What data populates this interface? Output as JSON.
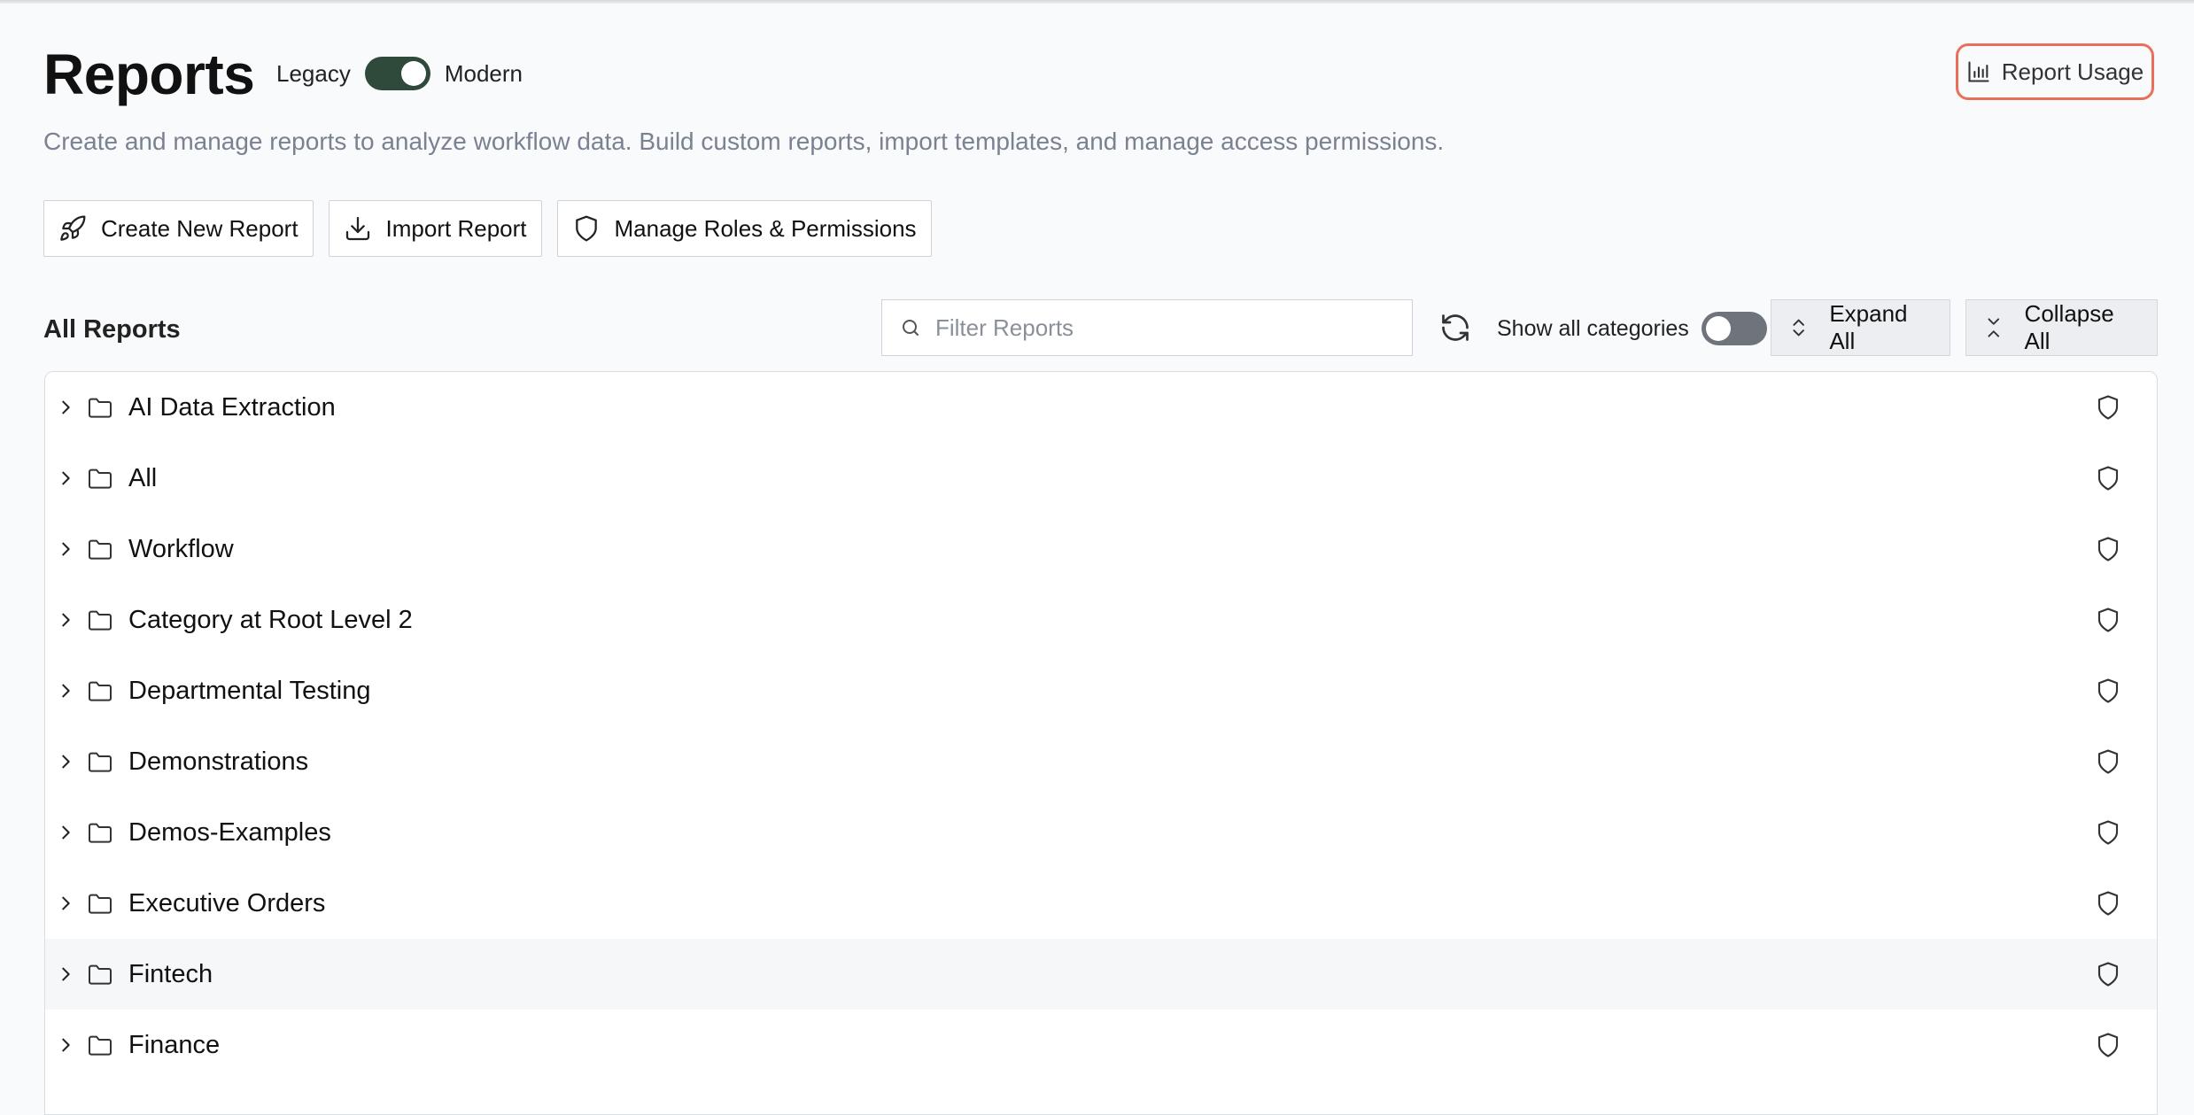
{
  "header": {
    "title": "Reports",
    "mode_left": "Legacy",
    "mode_right": "Modern",
    "subtitle": "Create and manage reports to analyze workflow data. Build custom reports, import templates, and manage access permissions.",
    "usage_button": "Report Usage"
  },
  "actions": {
    "create": "Create New Report",
    "import": "Import Report",
    "roles": "Manage Roles & Permissions"
  },
  "toolbar": {
    "section_title": "All Reports",
    "filter_placeholder": "Filter Reports",
    "show_all_label": "Show all categories",
    "expand_all": "Expand All",
    "collapse_all": "Collapse All"
  },
  "categories": [
    "AI Data Extraction",
    "All",
    "Workflow",
    "Category at Root Level 2",
    "Departmental Testing",
    "Demonstrations",
    "Demos-Examples",
    "Executive Orders",
    "Fintech",
    "Finance"
  ],
  "colors": {
    "toggle_on": "#2f4a3a",
    "toggle_off": "#6e737c",
    "usage_border": "#e8705a"
  }
}
